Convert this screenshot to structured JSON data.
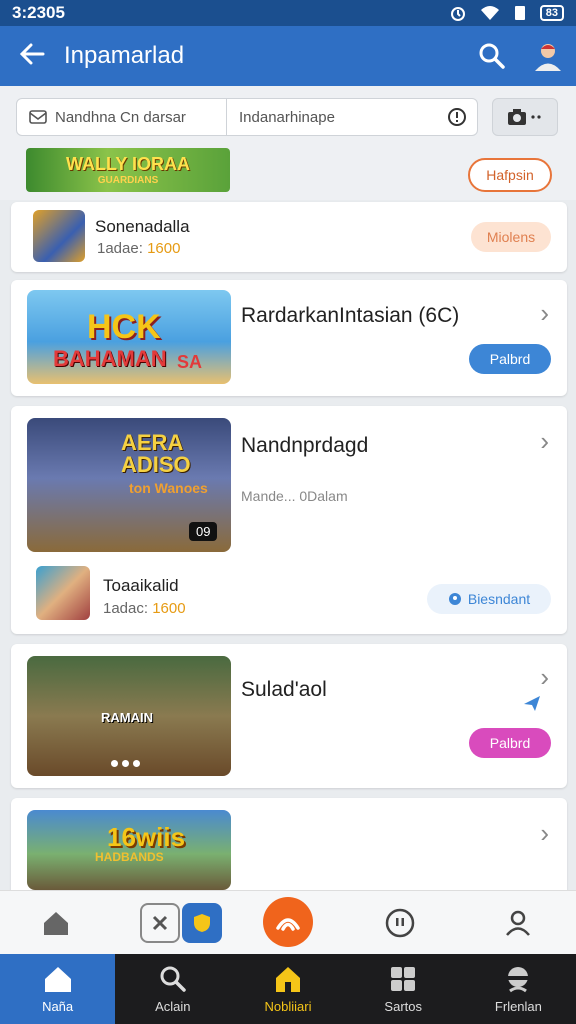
{
  "status_bar": {
    "time": "3:2305",
    "battery": "83"
  },
  "app_bar": {
    "title": "Inpamarlad"
  },
  "search": {
    "category_placeholder": "Nandhna Cn  darsar",
    "query_placeholder": "Indanarhinape"
  },
  "banner": {
    "art_title": "WALLY IORAA",
    "art_subtitle": "GUARDIANS",
    "button_label": "Hafpsin"
  },
  "items": [
    {
      "name": "Sonenadalla",
      "meta_label": "1adae:",
      "meta_value": "1600",
      "button_label": "Miolens"
    },
    {
      "title": "RardarkanIntasian (6C)",
      "art_text": "HCK",
      "art_subtitle": "BAHAMAN",
      "art_badge": "SA",
      "button_label": "Palbrd"
    },
    {
      "title": "Nandnprdagd",
      "art_text": "AERA ADISO",
      "art_subtitle": "ton Wanoes",
      "art_badge": "09",
      "subtext": "Mande... 0Dalam",
      "sub_name": "Toaaikalid",
      "sub_meta_label": "1adac:",
      "sub_meta_value": "1600",
      "sub_button_label": "Biesndant"
    },
    {
      "title": "Sulad'aol",
      "art_text": "RAMAIN",
      "button_label": "Palbrd"
    },
    {
      "art_text": "16wiis",
      "art_subtitle": "HADBANDS"
    }
  ],
  "bottom_nav": [
    {
      "label": "Naña",
      "icon": "home-icon"
    },
    {
      "label": "Aclain",
      "icon": "search-icon"
    },
    {
      "label": "Nobliiari",
      "icon": "house-icon"
    },
    {
      "label": "Sartos",
      "icon": "grid-icon"
    },
    {
      "label": "Frlenlan",
      "icon": "profile-icon"
    }
  ],
  "colors": {
    "primary": "#2f6fc4",
    "orange": "#f0641c",
    "blue_pill": "#3d86d6",
    "pink_pill": "#d94bbd",
    "gold": "#e69b14"
  }
}
